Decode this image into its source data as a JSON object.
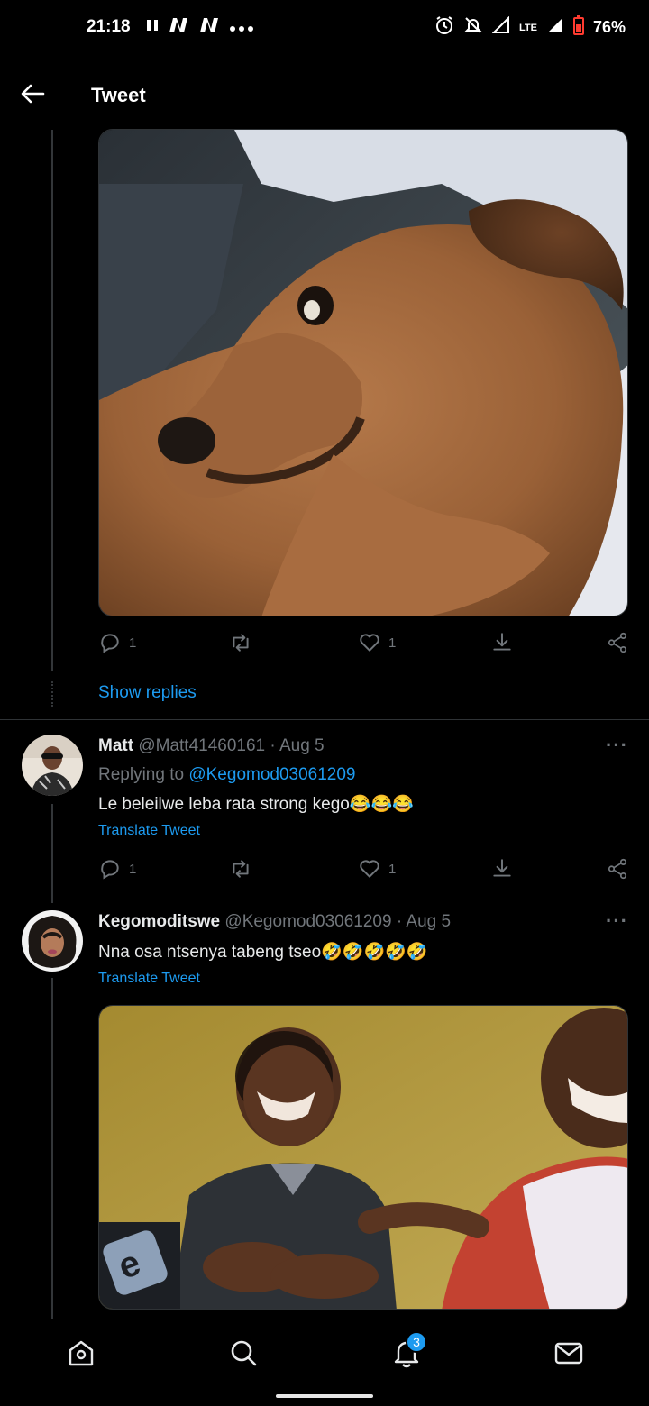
{
  "status_bar": {
    "time": "21:18",
    "left_icons": [
      "pause-icon",
      "netflix-icon",
      "netflix-icon",
      "more-dots-icon"
    ],
    "network": "LTE",
    "battery": "76%"
  },
  "header": {
    "title": "Tweet"
  },
  "first_tweet": {
    "image_alt": "dog-photo",
    "reply_count": "1",
    "retweet_count": "",
    "like_count": "1",
    "show_replies": "Show replies"
  },
  "reply1": {
    "name": "Matt",
    "handle": "@Matt41460161",
    "date": "· Aug 5",
    "replying_prefix": "Replying to",
    "replying_to": "@Kegomod03061209",
    "text": "Le beleilwe leba rata strong kego😂😂😂",
    "translate": "Translate Tweet",
    "reply_count": "1",
    "like_count": "1"
  },
  "reply2": {
    "name": "Kegomoditswe",
    "handle": "@Kegomod03061209",
    "date": "· Aug 5",
    "text": "Nna osa ntsenya tabeng tseo🤣🤣🤣🤣🤣",
    "translate": "Translate Tweet",
    "image_alt": "two-men-laughing-photo"
  },
  "bottom_nav": {
    "items": [
      "home",
      "search",
      "notifications",
      "messages"
    ],
    "notification_badge": "3"
  },
  "colors": {
    "background": "#000000",
    "accent": "#1d9bf0",
    "secondary_text": "#71767b",
    "divider": "#2f3336"
  }
}
